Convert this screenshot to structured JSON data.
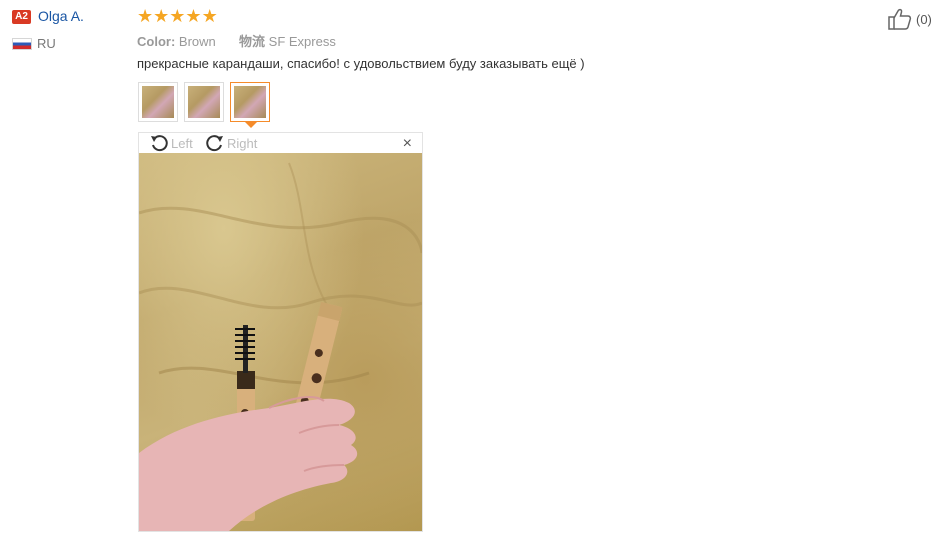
{
  "reviewer": {
    "level_badge": "A2",
    "name": "Olga A.",
    "country": "RU"
  },
  "rating": {
    "stars": 5,
    "max": 5
  },
  "attributes": {
    "color_label": "Color:",
    "color_value": "Brown",
    "shipping_label": "物流",
    "shipping_value": "SF Express"
  },
  "review": {
    "text": "прекрасные карандаши, спасибо! с удовольствием буду заказывать ещё )"
  },
  "photos": {
    "count": 3,
    "active_index": 3
  },
  "viewer": {
    "rotate_left_label": "Left",
    "rotate_right_label": "Right",
    "close_symbol": "×"
  },
  "helpful": {
    "count": "(0)",
    "icon": "thumbs-up-icon"
  },
  "colors": {
    "badge": "#d93a24",
    "username": "#1a56a4",
    "star": "#f5a623",
    "active_border": "#f58b2a"
  }
}
